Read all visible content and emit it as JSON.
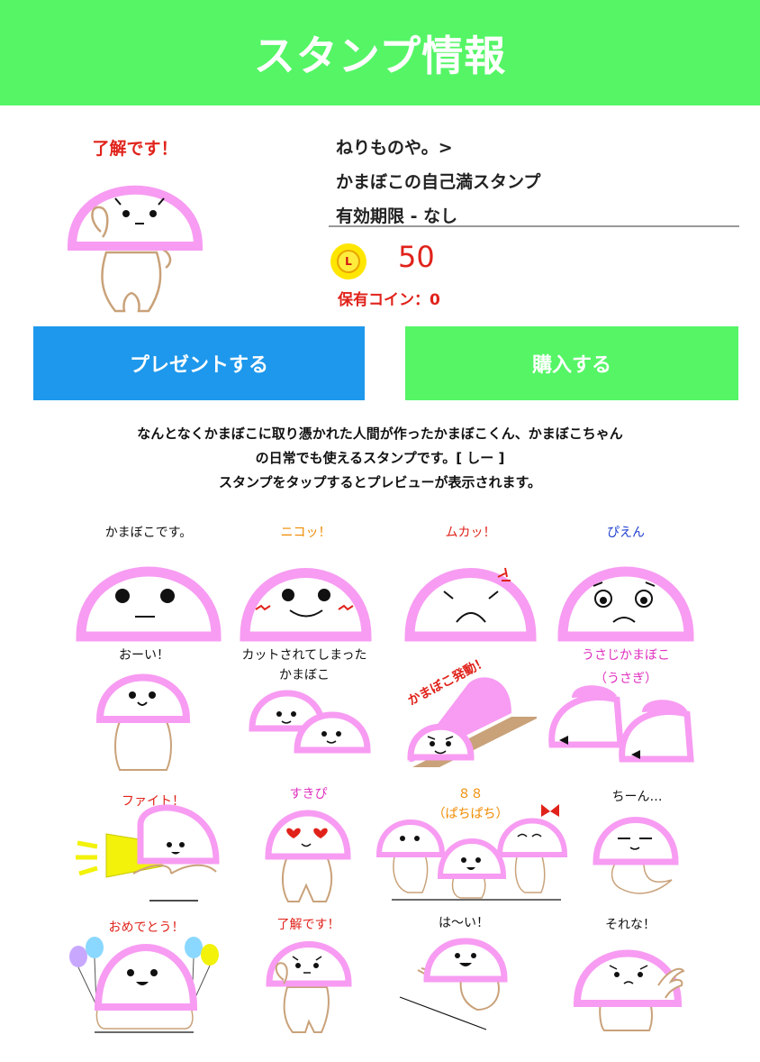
{
  "header": {
    "title": "スタンプ情報"
  },
  "main_stamp": {
    "caption": "了解です！"
  },
  "info": {
    "author": "ねりものや。>",
    "name": "かまぼこの自己満スタンプ",
    "validity": "有効期限 - なし"
  },
  "price": {
    "coin_letter": "L",
    "amount": "50",
    "owned": "保有コイン：0"
  },
  "buttons": {
    "present": "プレゼントする",
    "buy": "購入する"
  },
  "description": {
    "line1": "なんとなくかまぼこに取り憑かれた人間が作ったかまぼこくん、かまぼこちゃん",
    "line2": "の日常でも使えるスタンプです。[ しー ]",
    "line3": "スタンプをタップするとプレビューが表示されます。"
  },
  "stamps": [
    {
      "caption": "かまぼこです。",
      "color": "#111111"
    },
    {
      "caption": "ニコッ！",
      "color": "#f08a00"
    },
    {
      "caption": "ムカッ！",
      "color": "#e0221a"
    },
    {
      "caption": "ぴえん",
      "color": "#2040d0"
    },
    {
      "caption": "おーい！",
      "color": "#111111"
    },
    {
      "caption": "カットされてしまった",
      "caption2": "かまぼこ",
      "color": "#111111"
    },
    {
      "caption": "かまぼこ発動！",
      "color": "#e0221a"
    },
    {
      "caption": "うさじかまぼこ",
      "caption2": "（うさぎ）",
      "color": "#e030c0"
    },
    {
      "caption": "ファイト！",
      "color": "#e0221a"
    },
    {
      "caption": "すきぴ",
      "color": "#e030c0"
    },
    {
      "caption": "８８",
      "caption2": "（ぱちぱち）",
      "color": "#f08a00"
    },
    {
      "caption": "ちーん…",
      "color": "#111111"
    },
    {
      "caption": "おめでとう！",
      "color": "#e0221a"
    },
    {
      "caption": "了解です！",
      "color": "#e0221a"
    },
    {
      "caption": "は〜い！",
      "color": "#111111"
    },
    {
      "caption": "それな！",
      "color": "#111111"
    }
  ],
  "colors": {
    "header": "#55f566",
    "present": "#1e98ec",
    "buy": "#55f566",
    "kamaboko": "#f79cf2",
    "body": "#c9a27a"
  }
}
